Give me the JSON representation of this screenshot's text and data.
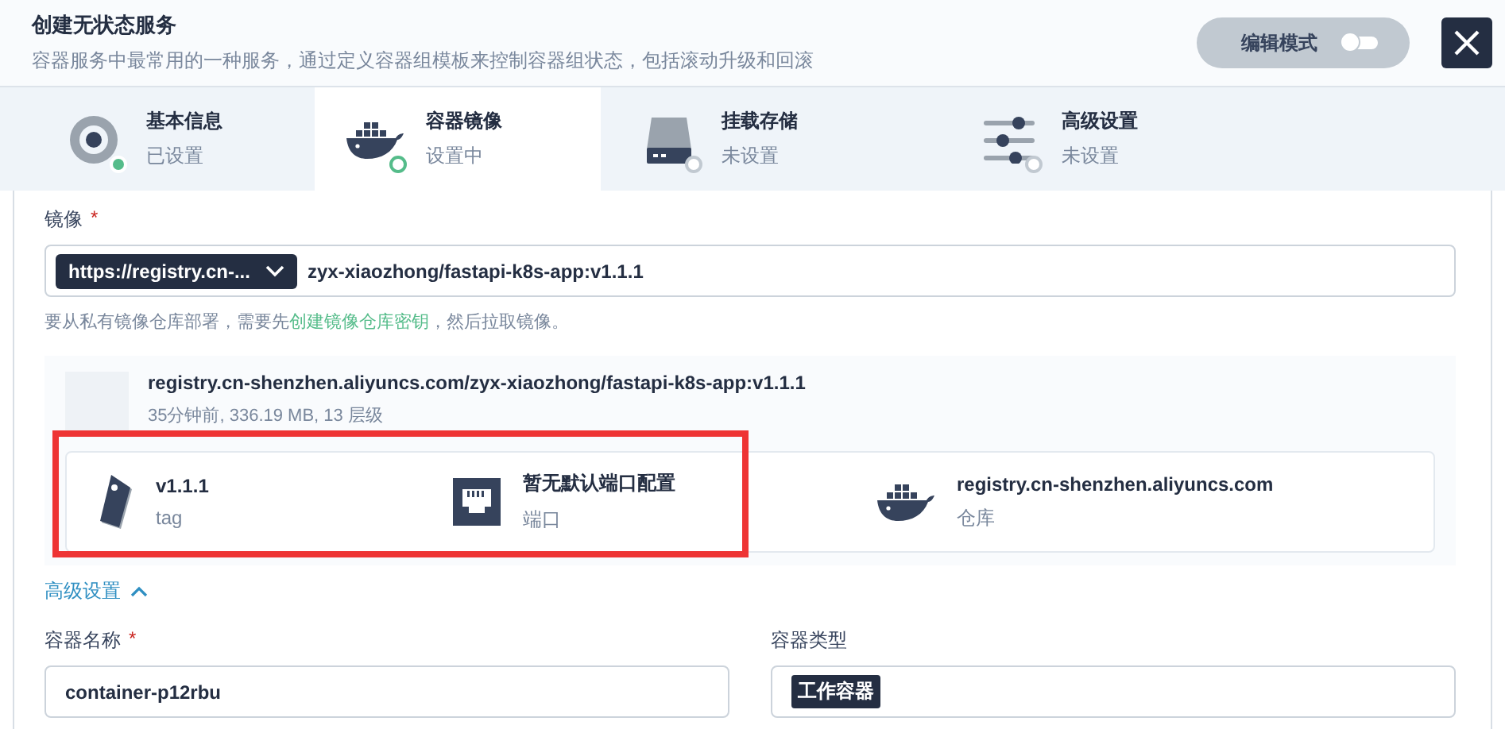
{
  "header": {
    "title": "创建无状态服务",
    "subtitle": "容器服务中最常用的一种服务，通过定义容器组模板来控制容器组状态，包括滚动升级和回滚",
    "edit_mode": {
      "label": "编辑模式",
      "on": false
    }
  },
  "steps": [
    {
      "title": "基本信息",
      "status": "已设置",
      "kind": "disk",
      "done": true,
      "selected": false
    },
    {
      "title": "容器镜像",
      "status": "设置中",
      "kind": "docker",
      "done": false,
      "selected": true
    },
    {
      "title": "挂载存储",
      "status": "未设置",
      "kind": "drive",
      "done": false,
      "selected": false
    },
    {
      "title": "高级设置",
      "status": "未设置",
      "kind": "sliders",
      "done": false,
      "selected": false
    }
  ],
  "image_field": {
    "label": "镜像",
    "required_mark": "*",
    "registry": "https://registry.cn-...",
    "value": "zyx-xiaozhong/fastapi-k8s-app:v1.1.1",
    "hint_before": "要从私有镜像仓库部署，需要先",
    "hint_link": "创建镜像仓库密钥",
    "hint_after": "，然后拉取镜像。"
  },
  "image_info": {
    "name": "registry.cn-shenzhen.aliyuncs.com/zyx-xiaozhong/fastapi-k8s-app:v1.1.1",
    "meta": "35分钟前, 336.19 MB, 13 层级",
    "details": [
      {
        "kind": "tag",
        "value": "v1.1.1",
        "label": "tag"
      },
      {
        "kind": "port",
        "value": "暂无默认端口配置",
        "label": "端口"
      },
      {
        "kind": "registry",
        "value": "registry.cn-shenzhen.aliyuncs.com",
        "label": "仓库"
      }
    ]
  },
  "advanced_toggle": {
    "label": "高级设置",
    "expanded": true
  },
  "container_name": {
    "label": "容器名称",
    "required_mark": "*",
    "value": "container-p12rbu"
  },
  "container_type": {
    "label": "容器类型",
    "value": "工作容器"
  },
  "annotation": {
    "kind": "highlight-rectangle"
  }
}
